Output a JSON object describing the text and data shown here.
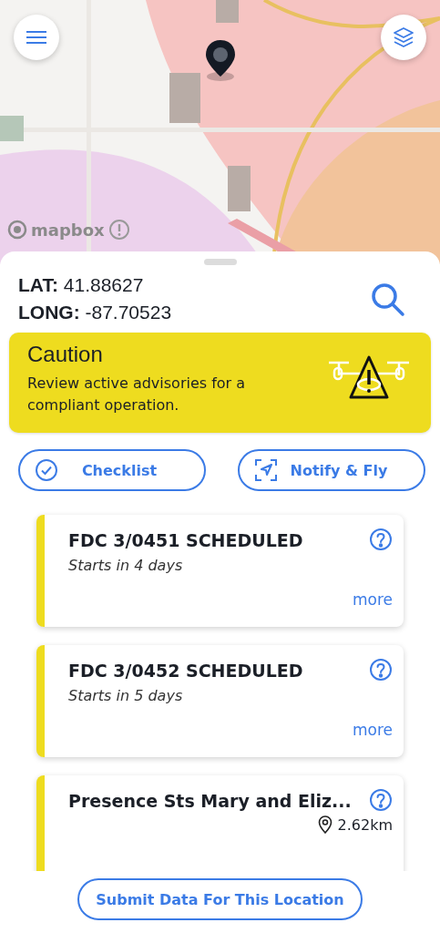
{
  "map": {
    "attribution": "mapbox"
  },
  "location": {
    "lat_label": "LAT:",
    "lat": "41.88627",
    "long_label": "LONG:",
    "long": "-87.70523"
  },
  "caution": {
    "title": "Caution",
    "text": "Review active advisories for a compliant operation."
  },
  "actions": [
    {
      "kind": "checklist",
      "label": "Checklist"
    },
    {
      "kind": "notify",
      "label": "Notify & Fly"
    }
  ],
  "advisories": [
    {
      "kind": "scheduled",
      "title": "FDC 3/0451 SCHEDULED",
      "subtitle": "Starts in 4 days",
      "link": "more",
      "color": "#eedc1f"
    },
    {
      "kind": "scheduled",
      "title": "FDC 3/0452 SCHEDULED",
      "subtitle": "Starts in 5 days",
      "link": "more",
      "color": "#eedc1f"
    },
    {
      "kind": "location",
      "title": "Presence Sts Mary and Eliz...",
      "distance": "2.62km",
      "color": "#eedc1f"
    }
  ],
  "submit_button": "Submit Data For This Location"
}
